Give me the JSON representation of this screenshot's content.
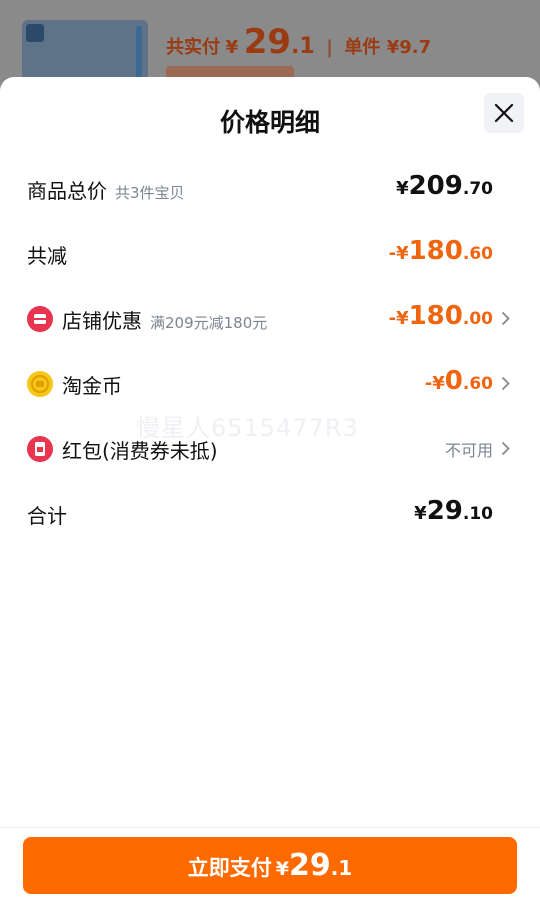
{
  "background": {
    "paid_label": "共实付",
    "paid_currency": "¥",
    "paid_int": "29",
    "paid_dec": ".1",
    "unit_label": "单件 ¥9.7"
  },
  "sheet": {
    "title": "价格明细",
    "rows": [
      {
        "label": "商品总价",
        "sub": "共3件宝贝",
        "currency": "¥",
        "int": "209",
        "dec": ".70"
      },
      {
        "label": "共减",
        "currency": "-¥",
        "int": "180",
        "dec": ".60"
      },
      {
        "label": "店铺优惠",
        "sub": "满209元减180元",
        "currency": "-¥",
        "int": "180",
        "dec": ".00"
      },
      {
        "label": "淘金币",
        "currency": "-¥",
        "int": "0",
        "dec": ".60"
      },
      {
        "label": "红包(消费券未抵)",
        "status": "不可用"
      },
      {
        "label": "合计",
        "currency": "¥",
        "int": "29",
        "dec": ".10"
      }
    ]
  },
  "watermark": "慢星人6515477R3",
  "pay_button": {
    "label": "立即支付",
    "currency": "¥",
    "int": "29",
    "dec": ".1"
  },
  "colors": {
    "accent": "#ff6a00",
    "discount": "#f0650f",
    "coupon_icon": "#e8344e",
    "coin_icon": "#f5c518"
  },
  "icons": [
    "close-icon",
    "shop-coupon-icon",
    "coin-icon",
    "red-packet-icon",
    "chevron-right-icon"
  ]
}
